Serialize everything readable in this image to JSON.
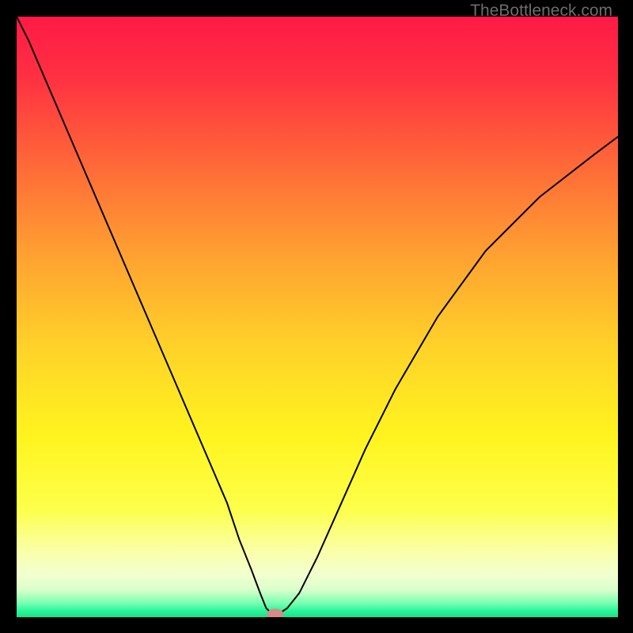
{
  "watermark": "TheBottleneck.com",
  "chart_data": {
    "type": "line",
    "title": "",
    "xlabel": "",
    "ylabel": "",
    "xlim": [
      0,
      100
    ],
    "ylim": [
      0,
      100
    ],
    "background": {
      "type": "vertical-gradient",
      "stops": [
        {
          "pos": 0.0,
          "color": "#ff1a45"
        },
        {
          "pos": 0.1,
          "color": "#ff3042"
        },
        {
          "pos": 0.25,
          "color": "#ff6a38"
        },
        {
          "pos": 0.4,
          "color": "#ffa231"
        },
        {
          "pos": 0.55,
          "color": "#ffd229"
        },
        {
          "pos": 0.7,
          "color": "#fff41f"
        },
        {
          "pos": 0.82,
          "color": "#fdff4a"
        },
        {
          "pos": 0.89,
          "color": "#faffa8"
        },
        {
          "pos": 0.93,
          "color": "#f2ffd0"
        },
        {
          "pos": 0.955,
          "color": "#d8ffca"
        },
        {
          "pos": 0.975,
          "color": "#80ffb4"
        },
        {
          "pos": 0.99,
          "color": "#28f59a"
        },
        {
          "pos": 1.0,
          "color": "#17e28a"
        }
      ]
    },
    "series": [
      {
        "name": "bottleneck-curve",
        "color": "#000000",
        "stroke_width": 2,
        "x": [
          0,
          2,
          5,
          8,
          11,
          14,
          17,
          20,
          23,
          26,
          29,
          32,
          35,
          37,
          39,
          40.5,
          41.5,
          42.5,
          43.5,
          45,
          47,
          50,
          54,
          58,
          63,
          70,
          78,
          87,
          96,
          100
        ],
        "y": [
          100,
          96,
          89,
          82,
          75,
          68,
          61,
          54,
          47,
          40,
          33,
          26,
          19,
          13,
          8,
          4,
          1.5,
          0.5,
          0.5,
          1.5,
          4,
          10,
          19,
          28,
          38,
          50,
          61,
          70,
          77,
          80
        ]
      }
    ],
    "markers": [
      {
        "x": 43,
        "y": 0.5,
        "color": "#d88a84",
        "rx": 1.4,
        "ry": 0.9
      }
    ]
  }
}
